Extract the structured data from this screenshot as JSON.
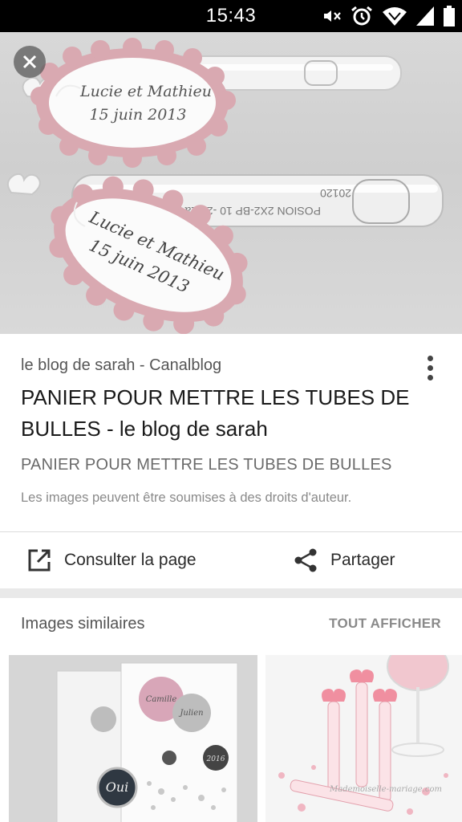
{
  "status_bar": {
    "time": "15:43",
    "icons": [
      "mute-icon",
      "alarm-icon",
      "wifi-icon",
      "signal-icon",
      "battery-icon"
    ]
  },
  "hero": {
    "tag_line_1": "Lucie et Mathieu",
    "tag_line_2": "15 juin 2013",
    "tube_print_1": "20120",
    "tube_print_2": "POSION 2X2-BP 10 -21 La pou"
  },
  "result": {
    "source": "le blog de sarah - Canalblog",
    "title": "PANIER POUR METTRE LES TUBES DE BULLES - le blog de sarah",
    "subtitle": "PANIER POUR METTRE LES TUBES DE BULLES",
    "copyright": "Les images peuvent être soumises à des droits d'auteur."
  },
  "actions": {
    "open_label": "Consulter la page",
    "share_label": "Partager"
  },
  "similar": {
    "title": "Images similaires",
    "see_all": "TOUT AFFICHER",
    "thumb1_text_1": "Oui",
    "thumb1_text_2": "Camille",
    "thumb1_text_3": "Julien",
    "thumb1_text_4": "2016",
    "thumb2_watermark": "Mademoiselle-mariage.com"
  }
}
